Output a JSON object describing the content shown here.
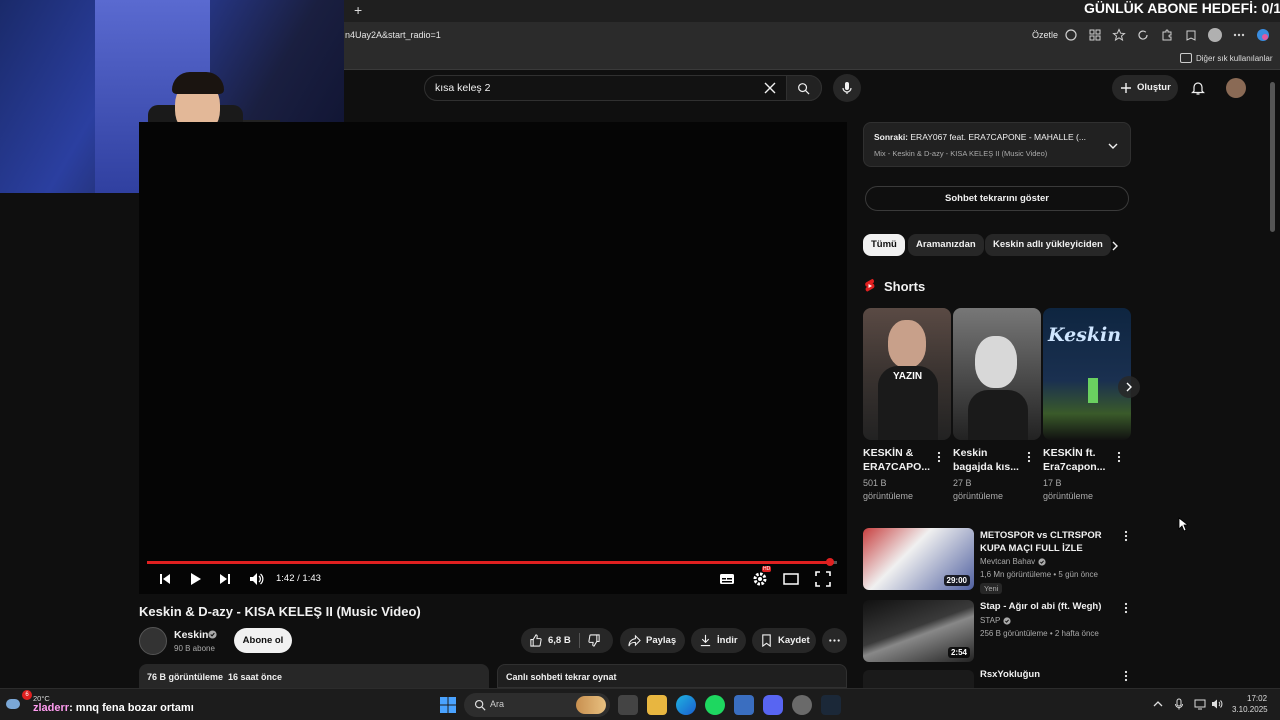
{
  "overlay": {
    "goal_text": "GÜNLÜK ABONE HEDEFİ: 0/1",
    "chat_user": "zladerr",
    "chat_message": ": mnq fena bozar ortamı",
    "weather": "20°C",
    "weather_badge": "6"
  },
  "browser": {
    "new_tab": "+",
    "url": "n4Uay2A&start_radio=1",
    "summarize": "Özetle",
    "bookmarks_label": "Diğer sık kullanılanlar"
  },
  "header": {
    "search_value": "kısa keleş 2",
    "create_label": "Oluştur"
  },
  "player": {
    "time": "1:42 / 1:43",
    "progress": 0.99,
    "settings_badge": "HD"
  },
  "video": {
    "title": "Keskin & D-azy - KISA KELEŞ II (Music Video)",
    "channel": "Keskin",
    "subscribers": "90 B abone",
    "subscribe_label": "Abone ol",
    "likes": "6,8 B",
    "share_label": "Paylaş",
    "download_label": "İndir",
    "save_label": "Kaydet",
    "views_line": "76 B görüntüleme  16 saat önce",
    "chat_replay": "Canlı sohbeti tekrar oynat"
  },
  "sidebar": {
    "next_prefix": "Sonraki:",
    "next_title": "ERAY067 feat. ERA7CAPONE - MAHALLE (...",
    "next_sub": "Mix - Keskin & D-azy - KISA KELEŞ II (Music Video)",
    "chat_replay_btn": "Sohbet tekrarını göster",
    "chips": [
      "Tümü",
      "Aramanızdan",
      "Keskin adlı yükleyiciden"
    ],
    "shorts_heading": "Shorts",
    "shorts": [
      {
        "title": "KESKİN & ERA7CAPO...",
        "views": "501 B",
        "views2": "görüntüleme",
        "overlay": "YAZIN"
      },
      {
        "title": "Keskin bagajda kıs...",
        "views": "27 B",
        "views2": "görüntüleme",
        "overlay": ""
      },
      {
        "title": "KESKİN ft. Era7capon...",
        "views": "17 B",
        "views2": "görüntüleme",
        "overlay": "Keskin"
      }
    ],
    "videos": [
      {
        "title": "METOSPOR vs CLTRSPOR KUPA MAÇI FULL İZLE",
        "channel": "Mevtcan Bahav",
        "meta": "1,6 Mn görüntüleme • 5 gün önce",
        "badge": "Yeni",
        "duration": "29:00"
      },
      {
        "title": "Stap - Ağır ol abi (ft. Wegh)",
        "channel": "STAP",
        "meta": "256 B görüntüleme • 2 hafta önce",
        "badge": "",
        "duration": "2:54"
      },
      {
        "title": "RsxYokluğun",
        "channel": "",
        "meta": "",
        "badge": "",
        "duration": ""
      }
    ]
  },
  "taskbar": {
    "search_label": "Ara",
    "time": "17:02",
    "date": "3.10.2025"
  },
  "colors": {
    "accent_red": "#e02020",
    "yt_bg": "#0f0f0f"
  }
}
